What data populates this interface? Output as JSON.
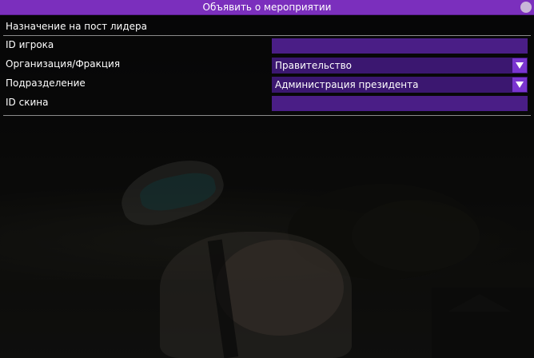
{
  "window": {
    "title": "Объявить о мероприятии"
  },
  "form": {
    "heading": "Назначение на пост лидера",
    "player_id": {
      "label": "ID игрока",
      "value": ""
    },
    "organization": {
      "label": "Организация/Фракция",
      "selected": "Правительство"
    },
    "subdivision": {
      "label": "Подразделение",
      "selected": "Администрация президента"
    },
    "skin_id": {
      "label": "ID скина",
      "value": ""
    }
  },
  "colors": {
    "titlebar": "#7b2fbd",
    "input_bg": "#4a1e86",
    "select_bg": "#3b1770",
    "arrow_bg": "#7a35d0"
  }
}
